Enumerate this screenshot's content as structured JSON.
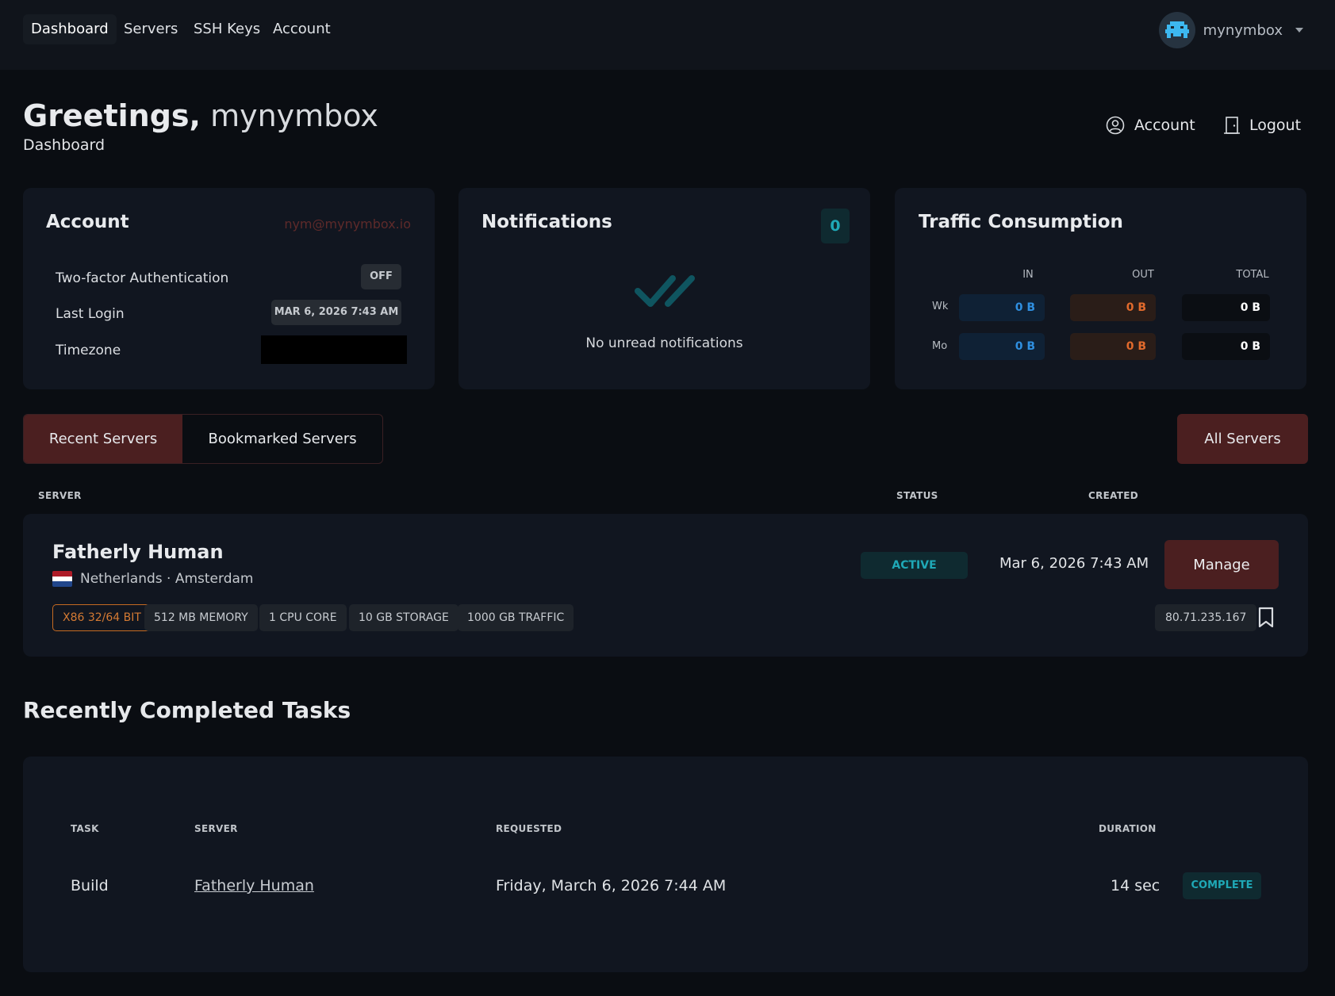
{
  "nav": {
    "links": [
      "Dashboard",
      "Servers",
      "SSH Keys",
      "Account"
    ],
    "active": "Dashboard",
    "user": "mynymbox"
  },
  "header": {
    "greeting": "Greetings,",
    "name": "mynymbox",
    "subtitle": "Dashboard",
    "account_label": "Account",
    "logout_label": "Logout"
  },
  "account_card": {
    "title": "Account",
    "email": "nym@mynymbox.io",
    "rows": [
      {
        "label": "Two-factor Authentication",
        "value": "OFF"
      },
      {
        "label": "Last Login",
        "value": "MAR 6, 2026 7:43 AM"
      },
      {
        "label": "Timezone",
        "value": ""
      }
    ]
  },
  "notifications": {
    "title": "Notifications",
    "count": "0",
    "empty_text": "No unread notifications"
  },
  "traffic": {
    "title": "Traffic Consumption",
    "columns": [
      "IN",
      "OUT",
      "TOTAL"
    ],
    "rows": [
      {
        "label": "Wk",
        "in": "0 B",
        "out": "0 B",
        "total": "0 B"
      },
      {
        "label": "Mo",
        "in": "0 B",
        "out": "0 B",
        "total": "0 B"
      }
    ]
  },
  "server_tabs": {
    "recent": "Recent Servers",
    "bookmarked": "Bookmarked Servers",
    "all_button": "All Servers"
  },
  "server_table": {
    "headers": {
      "server": "SERVER",
      "status": "STATUS",
      "created": "CREATED"
    },
    "server": {
      "name": "Fatherly Human",
      "location": "Netherlands · Amsterdam",
      "specs": [
        "X86 32/64 BIT",
        "512 MB MEMORY",
        "1 CPU CORE",
        "10 GB STORAGE",
        "1000 GB TRAFFIC"
      ],
      "status": "ACTIVE",
      "created": "Mar 6, 2026 7:43 AM",
      "manage_label": "Manage",
      "ip": "80.71.235.167"
    }
  },
  "tasks": {
    "title": "Recently Completed Tasks",
    "headers": {
      "task": "TASK",
      "server": "SERVER",
      "requested": "REQUESTED",
      "duration": "DURATION"
    },
    "rows": [
      {
        "task": "Build",
        "server": "Fatherly Human",
        "requested": "Friday, March 6, 2026 7:44 AM",
        "duration": "14 sec",
        "status": "COMPLETE"
      }
    ]
  },
  "colors": {
    "background": "#0a0d12",
    "card": "#111620",
    "accent_dark_red": "#4b1f20",
    "teal": "#1fa8b6",
    "in_blue": "#2f8fe0",
    "out_orange": "#e16a2c"
  }
}
